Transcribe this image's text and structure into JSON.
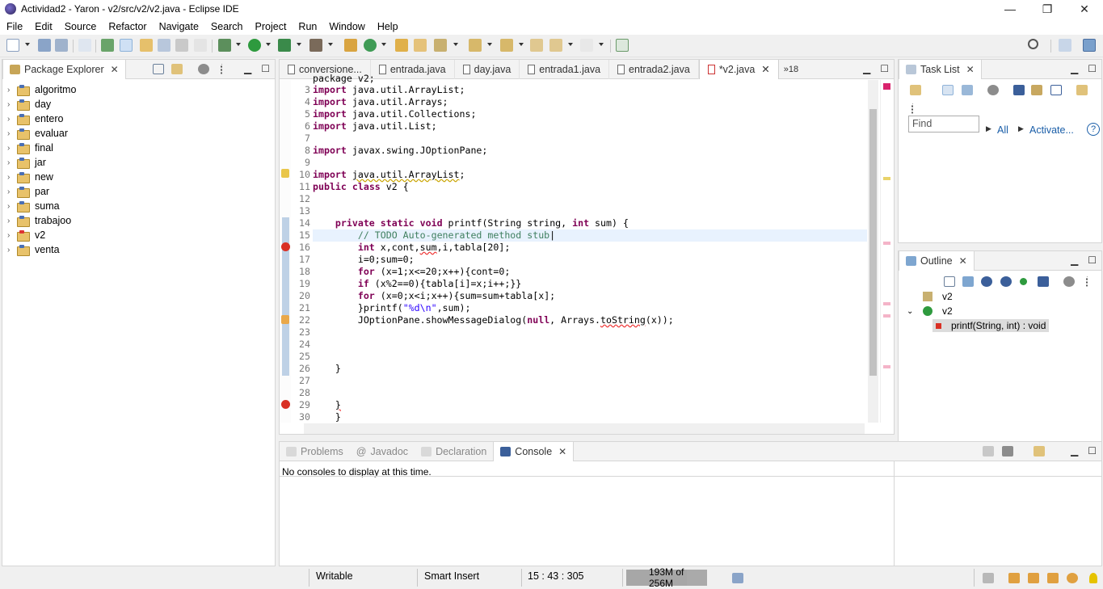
{
  "window": {
    "title": "Actividad2 - Yaron - v2/src/v2/v2.java - Eclipse IDE",
    "min": "—",
    "restore": "❐",
    "close": "✕"
  },
  "menu": [
    "File",
    "Edit",
    "Source",
    "Refactor",
    "Navigate",
    "Search",
    "Project",
    "Run",
    "Window",
    "Help"
  ],
  "package_explorer": {
    "title": "Package Explorer",
    "projects": [
      {
        "name": "algoritmo",
        "error": false
      },
      {
        "name": "day",
        "error": false
      },
      {
        "name": "entero",
        "error": false
      },
      {
        "name": "evaluar",
        "error": false
      },
      {
        "name": "final",
        "error": false
      },
      {
        "name": "jar",
        "error": false
      },
      {
        "name": "new",
        "error": false
      },
      {
        "name": "par",
        "error": false
      },
      {
        "name": "suma",
        "error": false
      },
      {
        "name": "trabajoo",
        "error": false
      },
      {
        "name": "v2",
        "error": true
      },
      {
        "name": "venta",
        "error": false
      }
    ]
  },
  "editor": {
    "tabs": [
      {
        "label": "conversione...",
        "active": false
      },
      {
        "label": "entrada.java",
        "active": false
      },
      {
        "label": "day.java",
        "active": false
      },
      {
        "label": "entrada1.java",
        "active": false
      },
      {
        "label": "entrada2.java",
        "active": false
      },
      {
        "label": "*v2.java",
        "active": true
      }
    ],
    "overflow": "»18",
    "lines": [
      {
        "n": "3",
        "fold": true,
        "text": "import java.util.ArrayList;"
      },
      {
        "n": "4",
        "text": "import java.util.Arrays;"
      },
      {
        "n": "5",
        "text": "import java.util.Collections;"
      },
      {
        "n": "6",
        "text": "import java.util.List;"
      },
      {
        "n": "7",
        "text": ""
      },
      {
        "n": "8",
        "text": "import javax.swing.JOptionPane;"
      },
      {
        "n": "9",
        "text": ""
      },
      {
        "n": "10",
        "marker": "warn",
        "text": "import java.util.ArrayList;"
      },
      {
        "n": "11",
        "text": "public class v2 {"
      },
      {
        "n": "12",
        "text": ""
      },
      {
        "n": "13",
        "text": ""
      },
      {
        "n": "14",
        "fold": true,
        "text": "    private static void printf(String string, int sum) {"
      },
      {
        "n": "15",
        "highlight": true,
        "text": "        // TODO Auto-generated method stub"
      },
      {
        "n": "16",
        "marker": "error",
        "text": "        int x,cont,sum,i,tabla[20];"
      },
      {
        "n": "17",
        "text": "        i=0;sum=0;"
      },
      {
        "n": "18",
        "text": "        for (x=1;x<=20;x++){cont=0;"
      },
      {
        "n": "19",
        "text": "        if (x%2==0){tabla[i]=x;i++;}}"
      },
      {
        "n": "20",
        "text": "        for (x=0;x<i;x++){sum=sum+tabla[x];"
      },
      {
        "n": "21",
        "text": "        }printf(\"%d\\n\",sum);"
      },
      {
        "n": "22",
        "marker": "errwarn",
        "text": "        JOptionPane.showMessageDialog(null, Arrays.toString(x));"
      },
      {
        "n": "23",
        "text": ""
      },
      {
        "n": "24",
        "text": ""
      },
      {
        "n": "25",
        "text": ""
      },
      {
        "n": "26",
        "text": "    }"
      },
      {
        "n": "27",
        "text": ""
      },
      {
        "n": "28",
        "text": ""
      },
      {
        "n": "29",
        "marker": "error",
        "text": "    }"
      },
      {
        "n": "30",
        "text": "    }"
      }
    ]
  },
  "task_list": {
    "title": "Task List",
    "find_placeholder": "Find",
    "all": "All",
    "activate": "Activate...",
    "help": "?"
  },
  "outline": {
    "title": "Outline",
    "items": [
      {
        "label": "v2",
        "kind": "package"
      },
      {
        "label": "v2",
        "kind": "class"
      },
      {
        "label": "printf(String, int) : void",
        "kind": "method"
      }
    ]
  },
  "bottom_panel": {
    "tabs": [
      {
        "label": "Problems",
        "active": false
      },
      {
        "label": "Javadoc",
        "active": false
      },
      {
        "label": "Declaration",
        "active": false
      },
      {
        "label": "Console",
        "active": true
      }
    ],
    "message": "No consoles to display at this time."
  },
  "status": {
    "writable": "Writable",
    "insert": "Smart Insert",
    "position": "15 : 43 : 305",
    "heap": "193M of 256M",
    "heap_used_fraction": 0.75
  },
  "colors": {
    "keyword": "#7f0055",
    "comment": "#3f7f5f",
    "string": "#2a00ff",
    "error": "#d93025",
    "link": "#1a5ea8"
  }
}
